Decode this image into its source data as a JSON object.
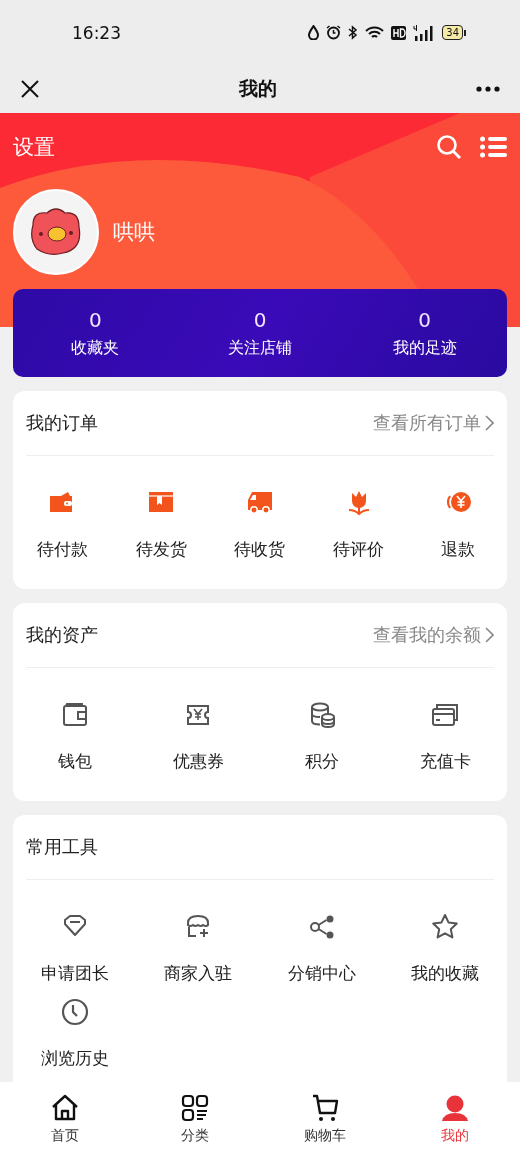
{
  "status_bar": {
    "time": "16:23",
    "battery": "34"
  },
  "nav_bar": {
    "title": "我的"
  },
  "header": {
    "settings": "设置",
    "username": "哄哄"
  },
  "stats": [
    {
      "value": "0",
      "label": "收藏夹"
    },
    {
      "value": "0",
      "label": "关注店铺"
    },
    {
      "value": "0",
      "label": "我的足迹"
    }
  ],
  "sections": [
    {
      "kind": "orders",
      "title": "我的订单",
      "link": "查看所有订单",
      "items": [
        "待付款",
        "待发货",
        "待收货",
        "待评价",
        "退款"
      ]
    },
    {
      "kind": "assets",
      "title": "我的资产",
      "link": "查看我的余额",
      "items": [
        "钱包",
        "优惠券",
        "积分",
        "充值卡"
      ]
    },
    {
      "kind": "tools",
      "title": "常用工具",
      "items": [
        "申请团长",
        "商家入驻",
        "分销中心",
        "我的收藏",
        "浏览历史"
      ]
    }
  ],
  "tabs": [
    {
      "label": "首页",
      "selected": false
    },
    {
      "label": "分类",
      "selected": false
    },
    {
      "label": "购物车",
      "selected": false
    },
    {
      "label": "我的",
      "selected": true
    }
  ]
}
